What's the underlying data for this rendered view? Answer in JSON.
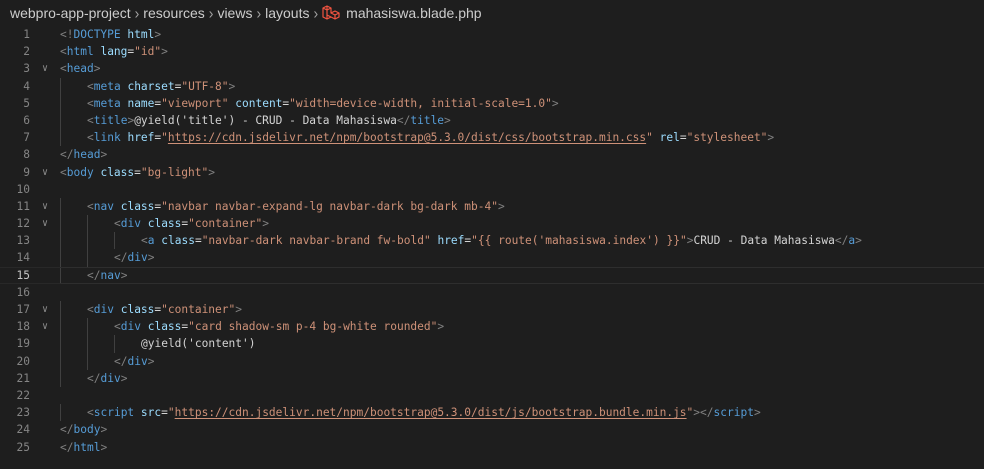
{
  "breadcrumb": {
    "items": [
      "webpro-app-project",
      "resources",
      "views",
      "layouts"
    ],
    "file_icon": "laravel-icon",
    "file_name": "mahasiswa.blade.php",
    "separator_icon": "chevron-right-icon"
  },
  "editor": {
    "current_line": 15,
    "colors": {
      "background": "#1e1e1e",
      "tag": "#569cd6",
      "attribute": "#9cdcfe",
      "string": "#ce9178",
      "bracket": "#808080",
      "text": "#d4d4d4",
      "line_number": "#858585",
      "laravel_red": "#f05340"
    },
    "lines": [
      {
        "num": "1",
        "indent": 0,
        "fold": false,
        "tokens": [
          [
            "b",
            "<!"
          ],
          [
            "g",
            "DOCTYPE"
          ],
          [
            "t",
            " "
          ],
          [
            "a",
            "html"
          ],
          [
            "b",
            ">"
          ]
        ]
      },
      {
        "num": "2",
        "indent": 0,
        "fold": false,
        "tokens": [
          [
            "b",
            "<"
          ],
          [
            "g",
            "html"
          ],
          [
            "t",
            " "
          ],
          [
            "a",
            "lang"
          ],
          [
            "t",
            "="
          ],
          [
            "s",
            "\"id\""
          ],
          [
            "b",
            ">"
          ]
        ]
      },
      {
        "num": "3",
        "indent": 0,
        "fold": true,
        "tokens": [
          [
            "b",
            "<"
          ],
          [
            "g",
            "head"
          ],
          [
            "b",
            ">"
          ]
        ]
      },
      {
        "num": "4",
        "indent": 1,
        "fold": false,
        "tokens": [
          [
            "b",
            "<"
          ],
          [
            "g",
            "meta"
          ],
          [
            "t",
            " "
          ],
          [
            "a",
            "charset"
          ],
          [
            "t",
            "="
          ],
          [
            "s",
            "\"UTF-8\""
          ],
          [
            "b",
            ">"
          ]
        ]
      },
      {
        "num": "5",
        "indent": 1,
        "fold": false,
        "tokens": [
          [
            "b",
            "<"
          ],
          [
            "g",
            "meta"
          ],
          [
            "t",
            " "
          ],
          [
            "a",
            "name"
          ],
          [
            "t",
            "="
          ],
          [
            "s",
            "\"viewport\""
          ],
          [
            "t",
            " "
          ],
          [
            "a",
            "content"
          ],
          [
            "t",
            "="
          ],
          [
            "s",
            "\"width=device-width, initial-scale=1.0\""
          ],
          [
            "b",
            ">"
          ]
        ]
      },
      {
        "num": "6",
        "indent": 1,
        "fold": false,
        "tokens": [
          [
            "b",
            "<"
          ],
          [
            "g",
            "title"
          ],
          [
            "b",
            ">"
          ],
          [
            "t",
            "@yield('title') - CRUD - Data Mahasiswa"
          ],
          [
            "b",
            "</"
          ],
          [
            "g",
            "title"
          ],
          [
            "b",
            ">"
          ]
        ]
      },
      {
        "num": "7",
        "indent": 1,
        "fold": false,
        "tokens": [
          [
            "b",
            "<"
          ],
          [
            "g",
            "link"
          ],
          [
            "t",
            " "
          ],
          [
            "a",
            "href"
          ],
          [
            "t",
            "="
          ],
          [
            "s",
            "\""
          ],
          [
            "u",
            "https://cdn.jsdelivr.net/npm/bootstrap@5.3.0/dist/css/bootstrap.min.css"
          ],
          [
            "s",
            "\""
          ],
          [
            "t",
            " "
          ],
          [
            "a",
            "rel"
          ],
          [
            "t",
            "="
          ],
          [
            "s",
            "\"stylesheet\""
          ],
          [
            "b",
            ">"
          ]
        ]
      },
      {
        "num": "8",
        "indent": 0,
        "fold": false,
        "tokens": [
          [
            "b",
            "</"
          ],
          [
            "g",
            "head"
          ],
          [
            "b",
            ">"
          ]
        ]
      },
      {
        "num": "9",
        "indent": 0,
        "fold": true,
        "tokens": [
          [
            "b",
            "<"
          ],
          [
            "g",
            "body"
          ],
          [
            "t",
            " "
          ],
          [
            "a",
            "class"
          ],
          [
            "t",
            "="
          ],
          [
            "s",
            "\"bg-light\""
          ],
          [
            "b",
            ">"
          ]
        ]
      },
      {
        "num": "10",
        "indent": 0,
        "fold": false,
        "tokens": []
      },
      {
        "num": "11",
        "indent": 1,
        "fold": true,
        "tokens": [
          [
            "b",
            "<"
          ],
          [
            "g",
            "nav"
          ],
          [
            "t",
            " "
          ],
          [
            "a",
            "class"
          ],
          [
            "t",
            "="
          ],
          [
            "s",
            "\"navbar navbar-expand-lg navbar-dark bg-dark mb-4\""
          ],
          [
            "b",
            ">"
          ]
        ]
      },
      {
        "num": "12",
        "indent": 2,
        "fold": true,
        "tokens": [
          [
            "b",
            "<"
          ],
          [
            "g",
            "div"
          ],
          [
            "t",
            " "
          ],
          [
            "a",
            "class"
          ],
          [
            "t",
            "="
          ],
          [
            "s",
            "\"container\""
          ],
          [
            "b",
            ">"
          ]
        ]
      },
      {
        "num": "13",
        "indent": 3,
        "fold": false,
        "tokens": [
          [
            "b",
            "<"
          ],
          [
            "g",
            "a"
          ],
          [
            "t",
            " "
          ],
          [
            "a",
            "class"
          ],
          [
            "t",
            "="
          ],
          [
            "s",
            "\"navbar-dark navbar-brand fw-bold\""
          ],
          [
            "t",
            " "
          ],
          [
            "a",
            "href"
          ],
          [
            "t",
            "="
          ],
          [
            "s",
            "\"{{ route('mahasiswa.index') }}\""
          ],
          [
            "b",
            ">"
          ],
          [
            "t",
            "CRUD - Data Mahasiswa"
          ],
          [
            "b",
            "</"
          ],
          [
            "g",
            "a"
          ],
          [
            "b",
            ">"
          ]
        ]
      },
      {
        "num": "14",
        "indent": 2,
        "fold": false,
        "tokens": [
          [
            "b",
            "</"
          ],
          [
            "g",
            "div"
          ],
          [
            "b",
            ">"
          ]
        ]
      },
      {
        "num": "15",
        "indent": 1,
        "fold": false,
        "tokens": [
          [
            "b",
            "</"
          ],
          [
            "g",
            "nav"
          ],
          [
            "b",
            ">"
          ]
        ]
      },
      {
        "num": "16",
        "indent": 0,
        "fold": false,
        "tokens": []
      },
      {
        "num": "17",
        "indent": 1,
        "fold": true,
        "tokens": [
          [
            "b",
            "<"
          ],
          [
            "g",
            "div"
          ],
          [
            "t",
            " "
          ],
          [
            "a",
            "class"
          ],
          [
            "t",
            "="
          ],
          [
            "s",
            "\"container\""
          ],
          [
            "b",
            ">"
          ]
        ]
      },
      {
        "num": "18",
        "indent": 2,
        "fold": true,
        "tokens": [
          [
            "b",
            "<"
          ],
          [
            "g",
            "div"
          ],
          [
            "t",
            " "
          ],
          [
            "a",
            "class"
          ],
          [
            "t",
            "="
          ],
          [
            "s",
            "\"card shadow-sm p-4 bg-white rounded\""
          ],
          [
            "b",
            ">"
          ]
        ]
      },
      {
        "num": "19",
        "indent": 3,
        "fold": false,
        "tokens": [
          [
            "t",
            "@yield('content')"
          ]
        ]
      },
      {
        "num": "20",
        "indent": 2,
        "fold": false,
        "tokens": [
          [
            "b",
            "</"
          ],
          [
            "g",
            "div"
          ],
          [
            "b",
            ">"
          ]
        ]
      },
      {
        "num": "21",
        "indent": 1,
        "fold": false,
        "tokens": [
          [
            "b",
            "</"
          ],
          [
            "g",
            "div"
          ],
          [
            "b",
            ">"
          ]
        ]
      },
      {
        "num": "22",
        "indent": 0,
        "fold": false,
        "tokens": []
      },
      {
        "num": "23",
        "indent": 1,
        "fold": false,
        "tokens": [
          [
            "b",
            "<"
          ],
          [
            "g",
            "script"
          ],
          [
            "t",
            " "
          ],
          [
            "a",
            "src"
          ],
          [
            "t",
            "="
          ],
          [
            "s",
            "\""
          ],
          [
            "u",
            "https://cdn.jsdelivr.net/npm/bootstrap@5.3.0/dist/js/bootstrap.bundle.min.js"
          ],
          [
            "s",
            "\""
          ],
          [
            "b",
            "></"
          ],
          [
            "g",
            "script"
          ],
          [
            "b",
            ">"
          ]
        ]
      },
      {
        "num": "24",
        "indent": 0,
        "fold": false,
        "tokens": [
          [
            "b",
            "</"
          ],
          [
            "g",
            "body"
          ],
          [
            "b",
            ">"
          ]
        ]
      },
      {
        "num": "25",
        "indent": 0,
        "fold": false,
        "tokens": [
          [
            "b",
            "</"
          ],
          [
            "g",
            "html"
          ],
          [
            "b",
            ">"
          ]
        ]
      }
    ]
  }
}
